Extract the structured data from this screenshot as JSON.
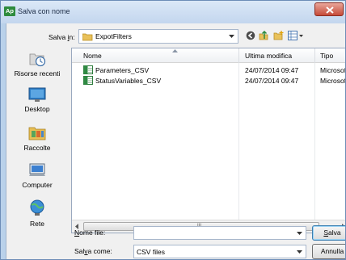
{
  "window": {
    "title": "Salva con nome",
    "app_icon": "Ap"
  },
  "toolbar": {
    "save_in_label": "Salva in:",
    "folder": "ExpotFilters",
    "buttons": [
      "back-icon",
      "up-folder-icon",
      "new-folder-icon",
      "view-menu-icon"
    ]
  },
  "places": [
    {
      "label": "Risorse recenti",
      "icon": "recent-places-icon"
    },
    {
      "label": "Desktop",
      "icon": "desktop-icon"
    },
    {
      "label": "Raccolte",
      "icon": "libraries-icon"
    },
    {
      "label": "Computer",
      "icon": "computer-icon"
    },
    {
      "label": "Rete",
      "icon": "network-icon"
    }
  ],
  "file_list": {
    "columns": [
      "Nome",
      "Ultima modifica",
      "Tipo"
    ],
    "rows": [
      {
        "name": "Parameters_CSV",
        "modified": "24/07/2014 09:47",
        "type": "Microsoft"
      },
      {
        "name": "StatusVariables_CSV",
        "modified": "24/07/2014 09:47",
        "type": "Microsoft"
      }
    ],
    "scroll_grip": "III"
  },
  "form": {
    "filename_label": "Nome file:",
    "filename_value": "",
    "filetype_label": "Salva come:",
    "filetype_value": "CSV files",
    "save_button": "Salva",
    "cancel_button": "Annulla"
  },
  "colors": {
    "accent": "#3c7fb1",
    "title_gradient": "#c3d6ee",
    "close": "#c54a38"
  }
}
